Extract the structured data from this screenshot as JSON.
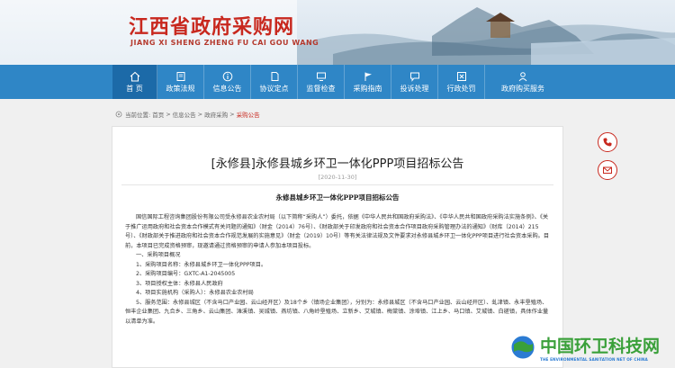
{
  "header": {
    "logo_cn": "江西省政府采购网",
    "logo_py": "JIANG XI SHENG ZHENG FU CAI GOU WANG"
  },
  "nav": {
    "items": [
      {
        "label": "首 页",
        "icon": "home-icon"
      },
      {
        "label": "政策法规",
        "icon": "book-icon"
      },
      {
        "label": "信息公告",
        "icon": "info-icon"
      },
      {
        "label": "协议定点",
        "icon": "document-icon"
      },
      {
        "label": "监督检查",
        "icon": "monitor-icon"
      },
      {
        "label": "采购指南",
        "icon": "flag-icon"
      },
      {
        "label": "投诉处理",
        "icon": "complaint-icon"
      },
      {
        "label": "行政处罚",
        "icon": "penalty-icon"
      },
      {
        "label": "政府购买服务",
        "icon": "service-icon"
      }
    ],
    "colors": {
      "bar": "#2f86c6",
      "active": "#1c6aa8"
    }
  },
  "breadcrumb": {
    "prefix": "当前位置:",
    "items": [
      "首页",
      "信息公告",
      "政府采购"
    ],
    "current": "采购公告",
    "separator": ">"
  },
  "article": {
    "title": "[永修县]永修县城乡环卫一体化PPP项目招标公告",
    "date": "[2020-11-30]",
    "subtitle": "永修县城乡环卫一体化PPP项目招标公告",
    "intro": "国信国际工程咨询集团股份有限公司受永修县农业农村局（以下简称“采购人”）委托，依据《中华人民共和国政府采购法》、《中华人民共和国政府采购法实施条例》、《关于推广运用政府和社会资本合作模式有关问题的通知》（财金（2014）76号）、《财政部关于印发政府和社会资本合作项目政府采购管理办法的通知》（财库（2014）215号）、《财政部关于推进政府和社会资本合作规范发展的实施意见》（财金（2019）10号）等有关法律法规及文件要求对永修县城乡环卫一体化PPP项目进行社会资本采购。目前，本项目已完成资格预审，现邀请通过资格预审的申请人参加本项目投标。",
    "section1": "一、采购项目概况",
    "items": [
      "1、采购项目名称：永修县城乡环卫一体化PPP项目。",
      "2、采购项目编号：GXTC-A1-2045005",
      "3、项目授权主体：永修县人民政府",
      "4、项目实施机构（采购人）：永修县农业农村局",
      "5、服务范围：永修县城区（不含马口产业园、云山经开区）及18个乡（镇场企业集团），分别为：永修县城区（不含马口产业园、云山经开区）、虬津镇、永丰垦殖场、恒丰企业集团、九合乡、三角乡、云山集团、滩溪镇、吴城镇、燕坊镇、八角岭垦殖场、立新乡、艾城镇、梅棠镇、涂埠镇、江上乡、马口镇、艾城镇、白槎镇，具体作业量以清单为准。"
    ]
  },
  "float_icons": [
    "phone-icon",
    "mail-icon"
  ],
  "watermark": {
    "cn": "中国环卫科技网",
    "en": "THE ENVIRONMENTAL SANITATION NET OF CHINA"
  }
}
